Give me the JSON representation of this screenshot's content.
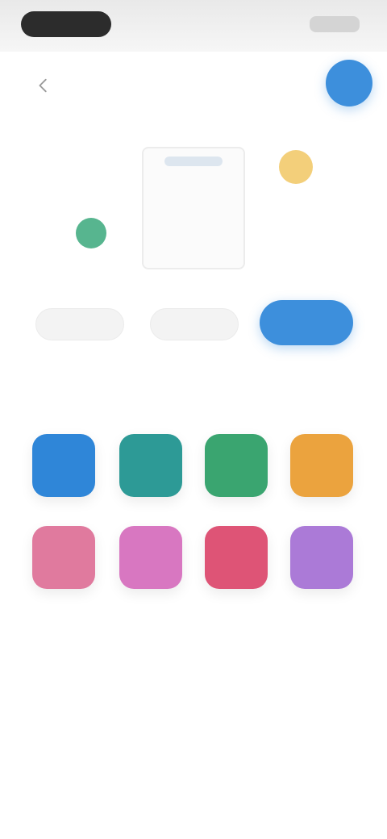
{
  "status_bar": {
    "time": "",
    "indicators": ""
  },
  "header": {
    "back_icon": "chevron-left-icon",
    "title": "",
    "avatar_color": "#3d8fdc"
  },
  "canvas": {
    "shelf_label": "",
    "yellow_orb_color": "#f3cf7a",
    "green_orb_color": "#57b58f"
  },
  "actions": {
    "secondary_left_label": "",
    "secondary_middle_label": "",
    "primary_label": "",
    "primary_color": "#3d8fdc"
  },
  "palette": {
    "title": "",
    "tiles": [
      {
        "color": "#2f86d8"
      },
      {
        "color": "#2d9a96"
      },
      {
        "color": "#3aa570"
      },
      {
        "color": "#eba33e"
      },
      {
        "color": "#e07a9e"
      },
      {
        "color": "#d877c1"
      },
      {
        "color": "#de5476"
      },
      {
        "color": "#ab7ad7"
      }
    ]
  }
}
